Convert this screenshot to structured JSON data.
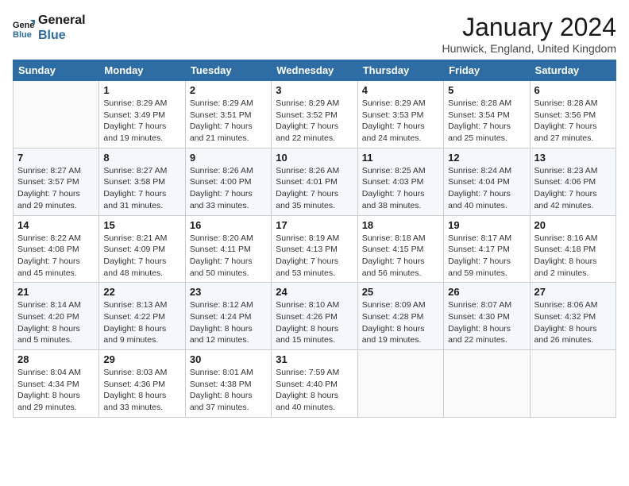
{
  "logo": {
    "line1": "General",
    "line2": "Blue"
  },
  "title": "January 2024",
  "subtitle": "Hunwick, England, United Kingdom",
  "days_of_week": [
    "Sunday",
    "Monday",
    "Tuesday",
    "Wednesday",
    "Thursday",
    "Friday",
    "Saturday"
  ],
  "weeks": [
    [
      {
        "day": "",
        "empty": true
      },
      {
        "day": "1",
        "sunrise": "Sunrise: 8:29 AM",
        "sunset": "Sunset: 3:49 PM",
        "daylight": "Daylight: 7 hours and 19 minutes."
      },
      {
        "day": "2",
        "sunrise": "Sunrise: 8:29 AM",
        "sunset": "Sunset: 3:51 PM",
        "daylight": "Daylight: 7 hours and 21 minutes."
      },
      {
        "day": "3",
        "sunrise": "Sunrise: 8:29 AM",
        "sunset": "Sunset: 3:52 PM",
        "daylight": "Daylight: 7 hours and 22 minutes."
      },
      {
        "day": "4",
        "sunrise": "Sunrise: 8:29 AM",
        "sunset": "Sunset: 3:53 PM",
        "daylight": "Daylight: 7 hours and 24 minutes."
      },
      {
        "day": "5",
        "sunrise": "Sunrise: 8:28 AM",
        "sunset": "Sunset: 3:54 PM",
        "daylight": "Daylight: 7 hours and 25 minutes."
      },
      {
        "day": "6",
        "sunrise": "Sunrise: 8:28 AM",
        "sunset": "Sunset: 3:56 PM",
        "daylight": "Daylight: 7 hours and 27 minutes."
      }
    ],
    [
      {
        "day": "7",
        "sunrise": "Sunrise: 8:27 AM",
        "sunset": "Sunset: 3:57 PM",
        "daylight": "Daylight: 7 hours and 29 minutes."
      },
      {
        "day": "8",
        "sunrise": "Sunrise: 8:27 AM",
        "sunset": "Sunset: 3:58 PM",
        "daylight": "Daylight: 7 hours and 31 minutes."
      },
      {
        "day": "9",
        "sunrise": "Sunrise: 8:26 AM",
        "sunset": "Sunset: 4:00 PM",
        "daylight": "Daylight: 7 hours and 33 minutes."
      },
      {
        "day": "10",
        "sunrise": "Sunrise: 8:26 AM",
        "sunset": "Sunset: 4:01 PM",
        "daylight": "Daylight: 7 hours and 35 minutes."
      },
      {
        "day": "11",
        "sunrise": "Sunrise: 8:25 AM",
        "sunset": "Sunset: 4:03 PM",
        "daylight": "Daylight: 7 hours and 38 minutes."
      },
      {
        "day": "12",
        "sunrise": "Sunrise: 8:24 AM",
        "sunset": "Sunset: 4:04 PM",
        "daylight": "Daylight: 7 hours and 40 minutes."
      },
      {
        "day": "13",
        "sunrise": "Sunrise: 8:23 AM",
        "sunset": "Sunset: 4:06 PM",
        "daylight": "Daylight: 7 hours and 42 minutes."
      }
    ],
    [
      {
        "day": "14",
        "sunrise": "Sunrise: 8:22 AM",
        "sunset": "Sunset: 4:08 PM",
        "daylight": "Daylight: 7 hours and 45 minutes."
      },
      {
        "day": "15",
        "sunrise": "Sunrise: 8:21 AM",
        "sunset": "Sunset: 4:09 PM",
        "daylight": "Daylight: 7 hours and 48 minutes."
      },
      {
        "day": "16",
        "sunrise": "Sunrise: 8:20 AM",
        "sunset": "Sunset: 4:11 PM",
        "daylight": "Daylight: 7 hours and 50 minutes."
      },
      {
        "day": "17",
        "sunrise": "Sunrise: 8:19 AM",
        "sunset": "Sunset: 4:13 PM",
        "daylight": "Daylight: 7 hours and 53 minutes."
      },
      {
        "day": "18",
        "sunrise": "Sunrise: 8:18 AM",
        "sunset": "Sunset: 4:15 PM",
        "daylight": "Daylight: 7 hours and 56 minutes."
      },
      {
        "day": "19",
        "sunrise": "Sunrise: 8:17 AM",
        "sunset": "Sunset: 4:17 PM",
        "daylight": "Daylight: 7 hours and 59 minutes."
      },
      {
        "day": "20",
        "sunrise": "Sunrise: 8:16 AM",
        "sunset": "Sunset: 4:18 PM",
        "daylight": "Daylight: 8 hours and 2 minutes."
      }
    ],
    [
      {
        "day": "21",
        "sunrise": "Sunrise: 8:14 AM",
        "sunset": "Sunset: 4:20 PM",
        "daylight": "Daylight: 8 hours and 5 minutes."
      },
      {
        "day": "22",
        "sunrise": "Sunrise: 8:13 AM",
        "sunset": "Sunset: 4:22 PM",
        "daylight": "Daylight: 8 hours and 9 minutes."
      },
      {
        "day": "23",
        "sunrise": "Sunrise: 8:12 AM",
        "sunset": "Sunset: 4:24 PM",
        "daylight": "Daylight: 8 hours and 12 minutes."
      },
      {
        "day": "24",
        "sunrise": "Sunrise: 8:10 AM",
        "sunset": "Sunset: 4:26 PM",
        "daylight": "Daylight: 8 hours and 15 minutes."
      },
      {
        "day": "25",
        "sunrise": "Sunrise: 8:09 AM",
        "sunset": "Sunset: 4:28 PM",
        "daylight": "Daylight: 8 hours and 19 minutes."
      },
      {
        "day": "26",
        "sunrise": "Sunrise: 8:07 AM",
        "sunset": "Sunset: 4:30 PM",
        "daylight": "Daylight: 8 hours and 22 minutes."
      },
      {
        "day": "27",
        "sunrise": "Sunrise: 8:06 AM",
        "sunset": "Sunset: 4:32 PM",
        "daylight": "Daylight: 8 hours and 26 minutes."
      }
    ],
    [
      {
        "day": "28",
        "sunrise": "Sunrise: 8:04 AM",
        "sunset": "Sunset: 4:34 PM",
        "daylight": "Daylight: 8 hours and 29 minutes."
      },
      {
        "day": "29",
        "sunrise": "Sunrise: 8:03 AM",
        "sunset": "Sunset: 4:36 PM",
        "daylight": "Daylight: 8 hours and 33 minutes."
      },
      {
        "day": "30",
        "sunrise": "Sunrise: 8:01 AM",
        "sunset": "Sunset: 4:38 PM",
        "daylight": "Daylight: 8 hours and 37 minutes."
      },
      {
        "day": "31",
        "sunrise": "Sunrise: 7:59 AM",
        "sunset": "Sunset: 4:40 PM",
        "daylight": "Daylight: 8 hours and 40 minutes."
      },
      {
        "day": "",
        "empty": true
      },
      {
        "day": "",
        "empty": true
      },
      {
        "day": "",
        "empty": true
      }
    ]
  ]
}
